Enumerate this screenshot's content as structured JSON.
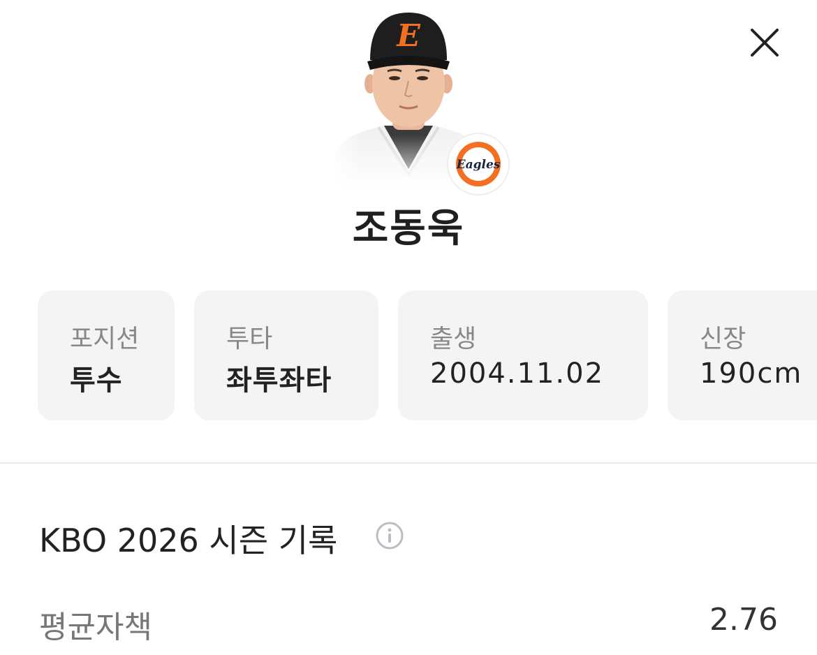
{
  "header": {
    "close_icon": "close-icon"
  },
  "player": {
    "name": "조동욱",
    "photo_icon": "player-photo",
    "team_logo": {
      "icon": "eagles-logo",
      "text": "Eagles"
    },
    "cap_letter": "E"
  },
  "info_cards": [
    {
      "label": "포지션",
      "value": "투수"
    },
    {
      "label": "투타",
      "value": "좌투좌타"
    },
    {
      "label": "출생",
      "value": "2004.11.02"
    },
    {
      "label": "신장",
      "value": "190cm"
    }
  ],
  "season": {
    "title": "KBO 2026 시즌 기록",
    "info_icon": "info-icon",
    "stats": [
      {
        "label": "평균자책",
        "value": "2.76"
      }
    ]
  },
  "colors": {
    "team_orange": "#F36F21",
    "card_bg": "#F4F4F4",
    "label_gray": "#888888"
  }
}
